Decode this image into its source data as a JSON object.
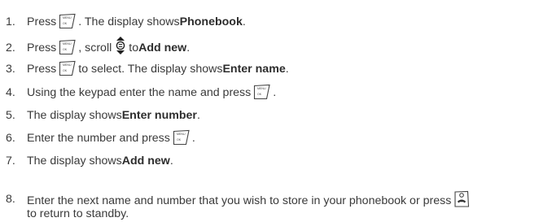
{
  "steps": [
    {
      "num": "1.",
      "a": "Press",
      "b": ". The display shows ",
      "bold": "Phonebook",
      "c": "."
    },
    {
      "num": "2.",
      "a": "Press",
      "b": ", scroll",
      "c": " to ",
      "bold": "Add new",
      "d": "."
    },
    {
      "num": "3.",
      "a": "Press",
      "b": " to select. The display shows ",
      "bold": "Enter name",
      "c": "."
    },
    {
      "num": "4.",
      "a": "Using the keypad enter the name and press",
      "b": "."
    },
    {
      "num": "5.",
      "a": "The display shows ",
      "bold": "Enter number",
      "b": "."
    },
    {
      "num": "6.",
      "a": "Enter the number and press",
      "b": "."
    },
    {
      "num": "7.",
      "a": "The display shows ",
      "bold": "Add new",
      "b": "."
    },
    {
      "num": "8.",
      "a": "Enter the next name and number that you wish to store in your phonebook or press",
      "b": "to return to standby."
    }
  ],
  "icons": {
    "menu_ok_key_text_top": "MENU",
    "menu_ok_key_text_bottom": "OK"
  }
}
